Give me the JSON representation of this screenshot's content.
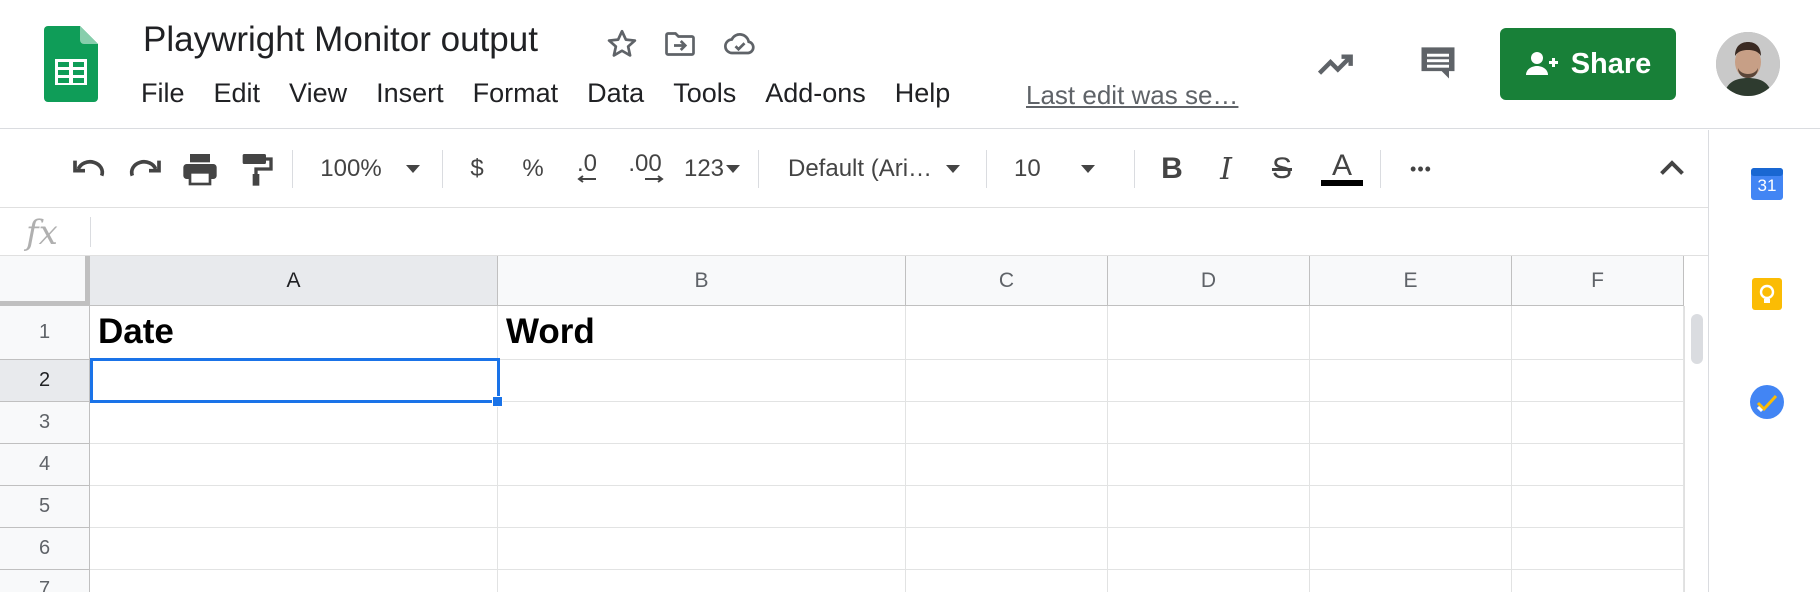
{
  "header": {
    "doc_title": "Playwright Monitor output",
    "menu": [
      "File",
      "Edit",
      "View",
      "Insert",
      "Format",
      "Data",
      "Tools",
      "Add-ons",
      "Help"
    ],
    "last_edit": "Last edit was se…",
    "share_label": "Share",
    "icons": [
      "sheets-logo-icon",
      "star-icon",
      "move-to-folder-icon",
      "cloud-saved-icon",
      "activity-trend-icon",
      "comments-icon",
      "share-person-icon",
      "user-avatar"
    ]
  },
  "toolbar": {
    "zoom": "100%",
    "currency": "$",
    "percent": "%",
    "decrease_decimal": ".0",
    "increase_decimal": ".00",
    "more_formats": "123",
    "font": "Default (Ari…",
    "font_size": "10",
    "bold": "B",
    "italic": "I",
    "strikethrough": "S",
    "text_color": "A",
    "more": "•••",
    "icons": [
      "undo-icon",
      "redo-icon",
      "print-icon",
      "paint-format-icon",
      "collapse-icon"
    ]
  },
  "formula_bar": {
    "fx": "fx",
    "value": ""
  },
  "grid": {
    "columns": [
      "A",
      "B",
      "C",
      "D",
      "E",
      "F"
    ],
    "rows": [
      "1",
      "2",
      "3",
      "4",
      "5",
      "6",
      "7"
    ],
    "cells": {
      "A1": "Date",
      "B1": "Word"
    },
    "selected_cell": "A2"
  },
  "side_panel": {
    "calendar_day": "31",
    "icons": [
      "calendar-icon",
      "keep-icon",
      "tasks-icon"
    ]
  },
  "colors": {
    "share_green": "#188038",
    "selection_blue": "#1a73e8",
    "sheets_green": "#0f9d58"
  }
}
